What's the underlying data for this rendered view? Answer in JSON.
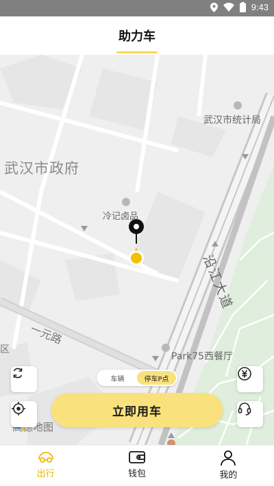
{
  "status_bar": {
    "time": "9:43",
    "icons": [
      "location-icon",
      "wifi-icon",
      "battery-icon"
    ]
  },
  "header": {
    "title": "助力车"
  },
  "map": {
    "labels": {
      "government": "武汉市政府",
      "statistics_bureau": "武汉市统计局",
      "lengji": "冷记卤品",
      "yiyuan_road": "一元路",
      "yanjiang_avenue": "沿江大道",
      "park75": "Park75西餐厅",
      "edge_text": "区"
    },
    "logo_text": "高德地图"
  },
  "toggle": {
    "options": [
      "车辆",
      "停车P点"
    ],
    "selected": "停车P点"
  },
  "cta": {
    "label": "立即用车"
  },
  "controls": [
    "refresh-icon",
    "locate-icon",
    "price-icon",
    "customer-service-icon"
  ],
  "bottom_nav": [
    {
      "label": "出行",
      "icon": "scooter-icon",
      "active": true
    },
    {
      "label": "钱包",
      "icon": "wallet-icon",
      "active": false
    },
    {
      "label": "我的",
      "icon": "user-icon",
      "active": false
    }
  ],
  "colors": {
    "accent": "#f9e27d",
    "active_nav": "#e9b800",
    "marker": "#f2c200",
    "park_green": "#dfeedd"
  }
}
